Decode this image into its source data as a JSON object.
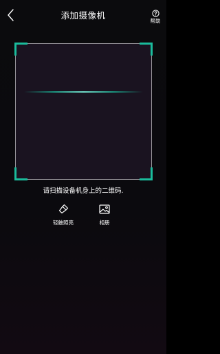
{
  "header": {
    "title": "添加摄像机",
    "back_icon": "chevron-left-icon",
    "help_icon": "question-circle-icon",
    "help_label": "帮助"
  },
  "scanner": {
    "hint": "请扫描设备机身上的二维码."
  },
  "tools": {
    "flashlight": {
      "label": "轻触照亮",
      "icon": "flashlight-icon"
    },
    "album": {
      "label": "相册",
      "icon": "image-icon"
    }
  },
  "colors": {
    "background": "#0b0b0d",
    "accent": "#1abc9c",
    "text": "#ffffff"
  }
}
